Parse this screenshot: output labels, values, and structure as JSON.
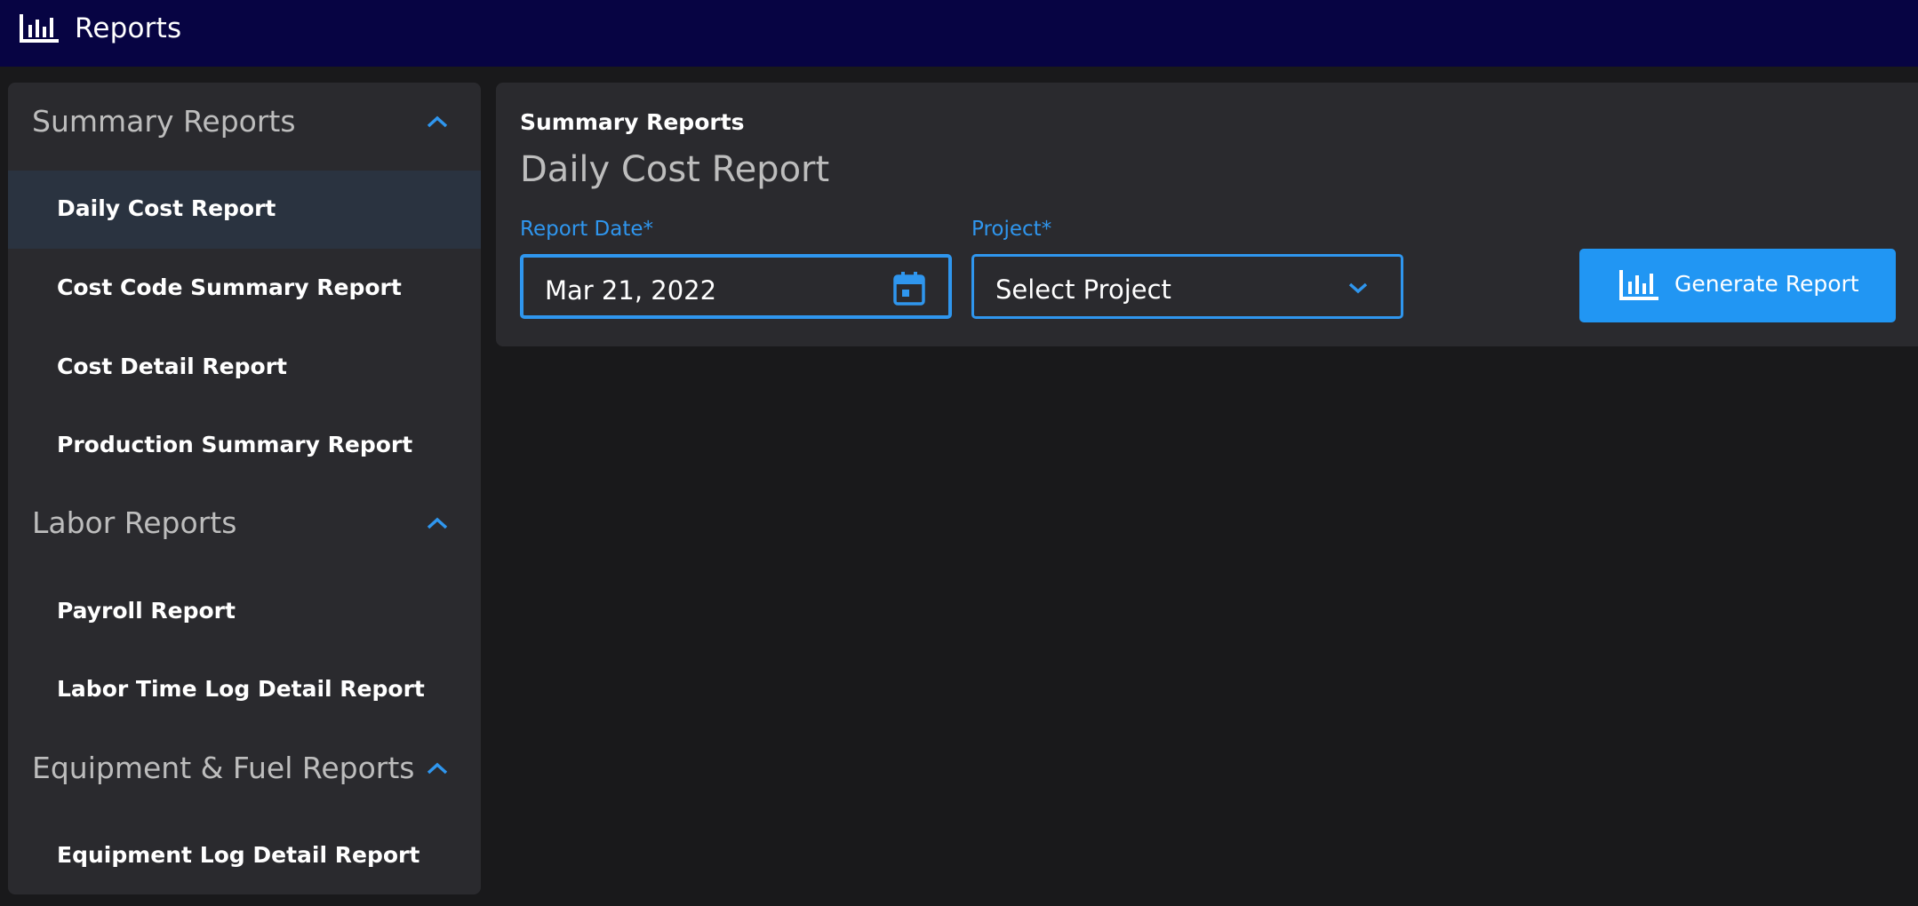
{
  "app": {
    "title": "Reports",
    "icon": "bar-chart-icon"
  },
  "sidebar": {
    "groups": [
      {
        "title": "Summary Reports",
        "expanded": true,
        "items": [
          {
            "label": "Daily Cost Report",
            "active": true
          },
          {
            "label": "Cost Code Summary Report",
            "active": false
          },
          {
            "label": "Cost Detail Report",
            "active": false
          },
          {
            "label": "Production Summary Report",
            "active": false
          }
        ]
      },
      {
        "title": "Labor Reports",
        "expanded": true,
        "items": [
          {
            "label": "Payroll Report",
            "active": false
          },
          {
            "label": "Labor Time Log Detail Report",
            "active": false
          }
        ]
      },
      {
        "title": "Equipment & Fuel Reports",
        "expanded": true,
        "items": [
          {
            "label": "Equipment Log Detail Report",
            "active": false
          }
        ]
      }
    ]
  },
  "main": {
    "breadcrumb": "Summary Reports",
    "title": "Daily Cost Report",
    "report_date": {
      "label": "Report Date*",
      "value": "Mar 21, 2022",
      "icon": "calendar-icon"
    },
    "project": {
      "label": "Project*",
      "value": "Select Project",
      "icon": "chevron-down-icon"
    },
    "generate_button": {
      "label": "Generate Report",
      "icon": "bar-chart-icon"
    }
  },
  "colors": {
    "topbar": "#070443",
    "background": "#19191b",
    "panel": "#2a2a2e",
    "accent": "#2196f3",
    "active_item": "#2a3340"
  }
}
